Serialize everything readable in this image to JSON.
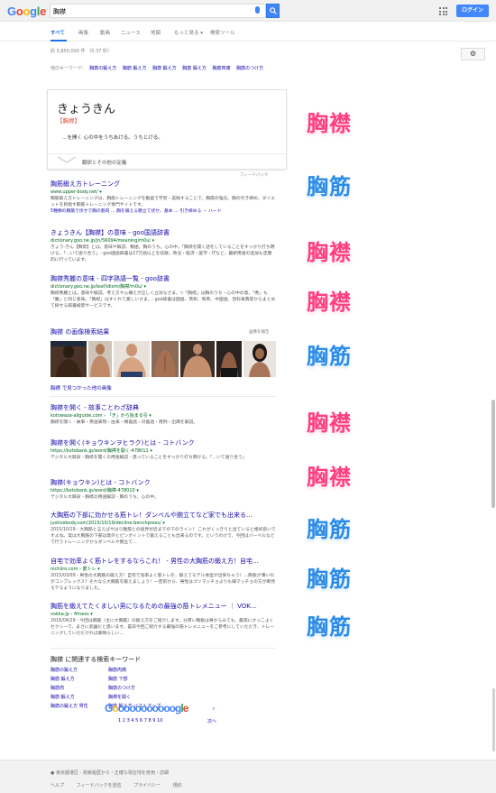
{
  "header": {
    "logo_letters": [
      {
        "ch": "G",
        "color": "#4285f4"
      },
      {
        "ch": "o",
        "color": "#ea4335"
      },
      {
        "ch": "o",
        "color": "#fbbc05"
      },
      {
        "ch": "g",
        "color": "#4285f4"
      },
      {
        "ch": "l",
        "color": "#34a853"
      },
      {
        "ch": "e",
        "color": "#ea4335"
      }
    ],
    "query": "胸襟",
    "login_label": "ログイン"
  },
  "tabs": [
    "すべて",
    "画像",
    "動画",
    "ニュース",
    "地図",
    "もっと見る ▾",
    "検索ツール"
  ],
  "stats": "約 5,850,000 件 （0.37 秒）",
  "other_keywords": {
    "label": "他のキーワード:",
    "items": [
      "胸筋の鍛え方",
      "胸筋 鍛え方",
      "胸筋 鍛え方",
      "胸筋 鍛え方",
      "胸筋肉痛",
      "胸筋のつけ方"
    ]
  },
  "dictionary": {
    "reading": "きょうきん",
    "kanji": "【胸襟】",
    "definition": "…を開く 心の中をうちあける。うちとける。",
    "more": "翻訳とその他の定義",
    "feedback": "フィードバック"
  },
  "results": [
    {
      "title": "胸筋鍛え方トレーニング",
      "url": "www.upper-body.net/ ▾",
      "snippet": "胸筋鍛え方トレーニングは、胸筋トレーニングを動画で学習・実践することで、胸筋の強化、胸の引き締め、ダイエットを目指す胸筋トレーニング専門サイトです。",
      "sub": "5種類の胸筋で伏せで胸の筋肉 … 胸を鍛える腕立て伏せ、基本 … 引き締める ・ ハード"
    },
    {
      "title": "きょうきん【胸襟】の意味 - goo国語辞書",
      "url": "dictionary.goo.ne.jp/jn/56094/meaning/m0u/ ▾",
      "snippet": "きょう‐きん【胸襟】とは。意味や解説、類語。胸のうち。心の中。「胸襟を開く話をしていることをすっかり打ち明ける。「…いて語り合う」- goo国語辞書は27万語以上を収録。政治・経済・医学・ITなど、最新用語の追加も定期的に行っています。",
      "sub": ""
    },
    {
      "title": "胸襟秀麗の意味 - 四字熟語一覧 - goo辞書",
      "url": "dictionary.goo.ne.jp/leaf/idiom/胸襟/m0u/ ▾",
      "snippet": "胸襟秀麗とは。意味や解説。考え方や心構えが正しく立派なさま。▽「胸襟」は胸のうち・心の中の意。「秀」も「麗」と同じ意味。「胸襟」はすぐれて美しいさま。- goo辞書は国語、英和、和英、中国語、百科事典等からまとめて探せる辞書検索サービスです。",
      "sub": ""
    }
  ],
  "images_section": {
    "heading": "胸襟 の画像検索結果",
    "report": "画像を報告",
    "more": "胸襟 で見つかった他の画像"
  },
  "results2": [
    {
      "title": "胸襟を開く - 故事ことわざ辞典",
      "url": "kotowaza-allguide.com › 「き」から始まる引 ▾",
      "snippet": "胸襟を開く - 故事・英語表現・由来・類義語・対義語・用例・出典を解説。",
      "sub": ""
    },
    {
      "title": "胸襟を開く(キョウキンヲヒラク)とは - コトバンク",
      "url": "https://kotobank.jp/word/胸襟を開く-478011 ▾",
      "snippet": "デジタル大辞泉 - 胸襟を開くの用語解説 - 思っていることをすっかり打ち明ける。「…いて語り合う」",
      "sub": ""
    },
    {
      "title": "胸襟(キョウキン)とは - コトバンク",
      "url": "https://kotobank.jp/word/胸襟-478010 ▾",
      "snippet": "デジタル大辞泉 - 胸襟の用語解説 - 胸のうち。心の中。",
      "sub": ""
    },
    {
      "title": "大胸筋の下部に効かせる筋トレ！ダンベルや腕立てなど家でも出来る…",
      "url": "justicebody.com/2015/10/19/decline-benchpress/ ▾",
      "snippet": "2015/10/19 - 大胸筋と言えばやはり腹筋との境界付近までの下のライン！ これがくっきりと出ていると格好良いですよね。実は大胸筋の下部は意外とピンポイントで鍛えることも出来るのです。というわけで、今回はバーベルなどで行うトレーニングからダンベルや腕立て…",
      "sub": ""
    },
    {
      "title": "自宅で効率よく筋トレをするならこれ！ - 男性の大胸筋の鍛え方！自宅…",
      "url": "nichiiro.com › 筋トレ ▾",
      "snippet": "2015/03/09 - 男性の大胸筋の鍛え方！自宅で効率よく筋トレを、鍛えてモデル体型が出来ちゃう！…胸板が薄いのがコンプレックス？それなら大胸筋を鍛えましょう！一昔前から、男性はゴツマッチョよりも細マッチョの方が断然モテるようになりました。",
      "sub": ""
    },
    {
      "title": "胸筋を鍛えてたくましい男になるための最強の筋トレメニュー ｜ VOK…",
      "url": "vokka.jp › fitness ▾",
      "snippet": "2016/04/29 - 今回は胸筋（主に大胸筋）の鍛え方をご紹介します。分厚い胸板は男からみても、最高にかっこよくセクシーで、まさに武器だと思います。是非今回ご紹介する最強の筋トレメニューをご参考にしていただき、トレーニングしていただければ素晴らしい…",
      "sub": ""
    }
  ],
  "related": {
    "heading": "胸襟 に関連する検索キーワード",
    "left": [
      "胸筋の鍛え方",
      "胸筋 鍛え方",
      "胸筋肉",
      "胸筋 鍛え方",
      "胸筋の鍛え方 男性"
    ],
    "right": [
      "胸筋肉痛",
      "胸筋 下部",
      "胸筋のつけ方",
      "胸襟を開く",
      "胸筋 鍛え方 バストアップ"
    ]
  },
  "pagination": {
    "pages": [
      "1",
      "2",
      "3",
      "4",
      "5",
      "6",
      "7",
      "8",
      "9",
      "10"
    ],
    "next": "次へ"
  },
  "footer": {
    "location": "● 東京都港区 - 検索履歴から・正確な現在地を使用・詳細",
    "links": [
      "ヘルプ",
      "フィードバックを送信",
      "プライバシー",
      "規約"
    ]
  },
  "annotations": [
    {
      "text": "胸襟",
      "color": "pink"
    },
    {
      "text": "胸筋",
      "color": "blue"
    },
    {
      "text": "胸襟",
      "color": "pink"
    },
    {
      "text": "胸襟",
      "color": "pink"
    },
    {
      "text": "胸筋",
      "color": "blue"
    },
    {
      "text": "胸襟",
      "color": "pink"
    },
    {
      "text": "胸襟",
      "color": "pink"
    },
    {
      "text": "胸筋",
      "color": "blue"
    },
    {
      "text": "胸筋",
      "color": "blue"
    },
    {
      "text": "胸筋",
      "color": "blue"
    }
  ]
}
